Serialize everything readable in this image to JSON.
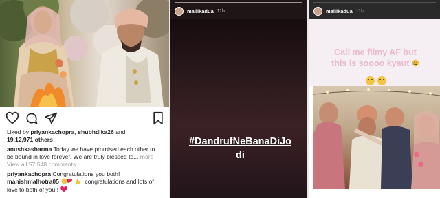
{
  "post": {
    "likes_prefix": "Liked by ",
    "likers": [
      "priyankachopra",
      "shubhdika26"
    ],
    "likes_joiner": ", ",
    "likes_and": " and",
    "likes_count": "19,12,971",
    "likes_suffix": " others",
    "caption_user": "anushkasharma",
    "caption_line1": " Today we have promised each other to",
    "caption_line2": "be bound in love forever. We are truly blessed to...",
    "more_label": " more",
    "view_comments": "View all 57,548 comments",
    "comment1_user": "priyankachopra",
    "comment1_text": " Congratulations you both!",
    "comment2_user": "manishmalhotra05",
    "comment2_text": " congratulations and lots of",
    "comment2_line2": "love to both of you!!",
    "icons": [
      "heart-icon",
      "comment-icon",
      "share-icon",
      "bookmark-icon"
    ]
  },
  "story_dark": {
    "username": "mallikadua",
    "time": "11h",
    "hashtag_line1": "#DandrufNeBanaDiJo",
    "hashtag_line2": "di"
  },
  "story_light": {
    "username": "mallikadua",
    "time": "11h",
    "text_line1": "Call me filmy AF but",
    "text_line2": "this is soooo kyaut"
  },
  "colors": {
    "story_dark_bg": "#1f1416",
    "filmy_text": "#e9b9cb",
    "heart_red": "#e0245e"
  }
}
